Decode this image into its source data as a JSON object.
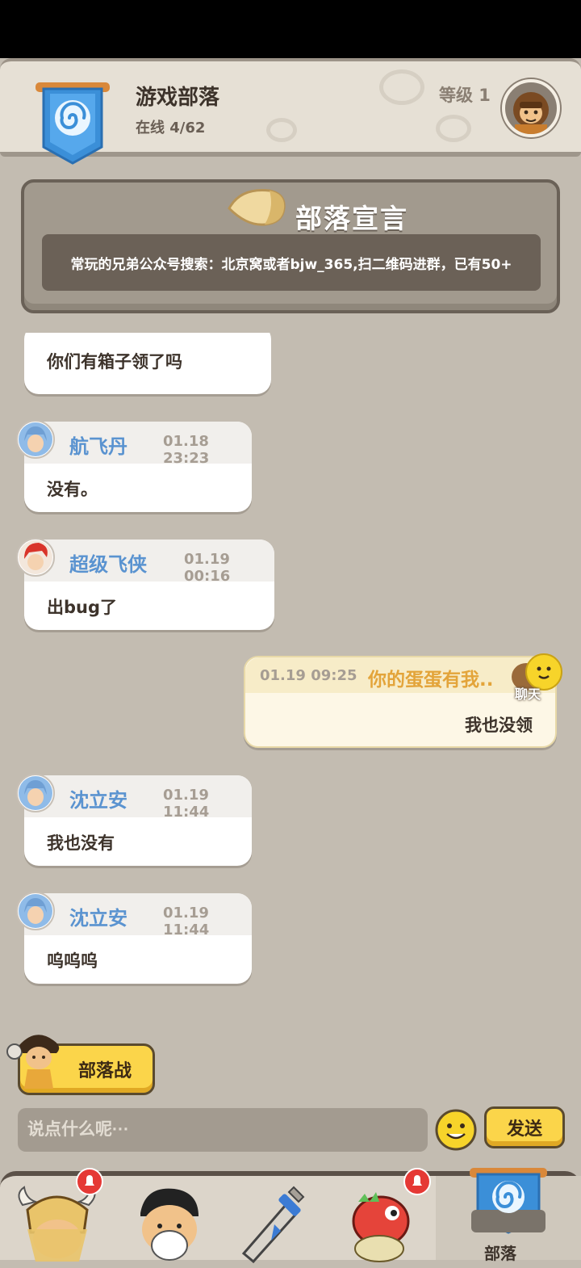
{
  "header": {
    "tribe_name": "游戏部落",
    "online": "在线 4/62",
    "level": "等级 1"
  },
  "manifesto": {
    "title": "部落宣言",
    "text": "常玩的兄弟公众号搜索：北京窝或者bjw_365,扫二维码进群，已有50+"
  },
  "messages": [
    {
      "text": "你们有箱子领了吗"
    },
    {
      "name": "航飞丹",
      "time": "01.18 23:23",
      "text": "没有。"
    },
    {
      "name": "超级飞侠",
      "time": "01.19 00:16",
      "text": "出bug了"
    },
    {
      "name": "你的蛋蛋有我..",
      "time": "01.19 09:25",
      "text": "我也没领",
      "badge": "聊天"
    },
    {
      "name": "沈立安",
      "time": "01.19 11:44",
      "text": "我也没有"
    },
    {
      "name": "沈立安",
      "time": "01.19 11:44",
      "text": "呜呜呜"
    }
  ],
  "actions": {
    "tribe_war": "部落战",
    "input_placeholder": "说点什么呢···",
    "send": "发送"
  },
  "nav": {
    "active_label": "部落"
  },
  "colors": {
    "accent_yellow": "#fbd54a",
    "name_blue": "#5a93d0",
    "my_name_orange": "#e3a43a",
    "notification_red": "#e53935"
  }
}
